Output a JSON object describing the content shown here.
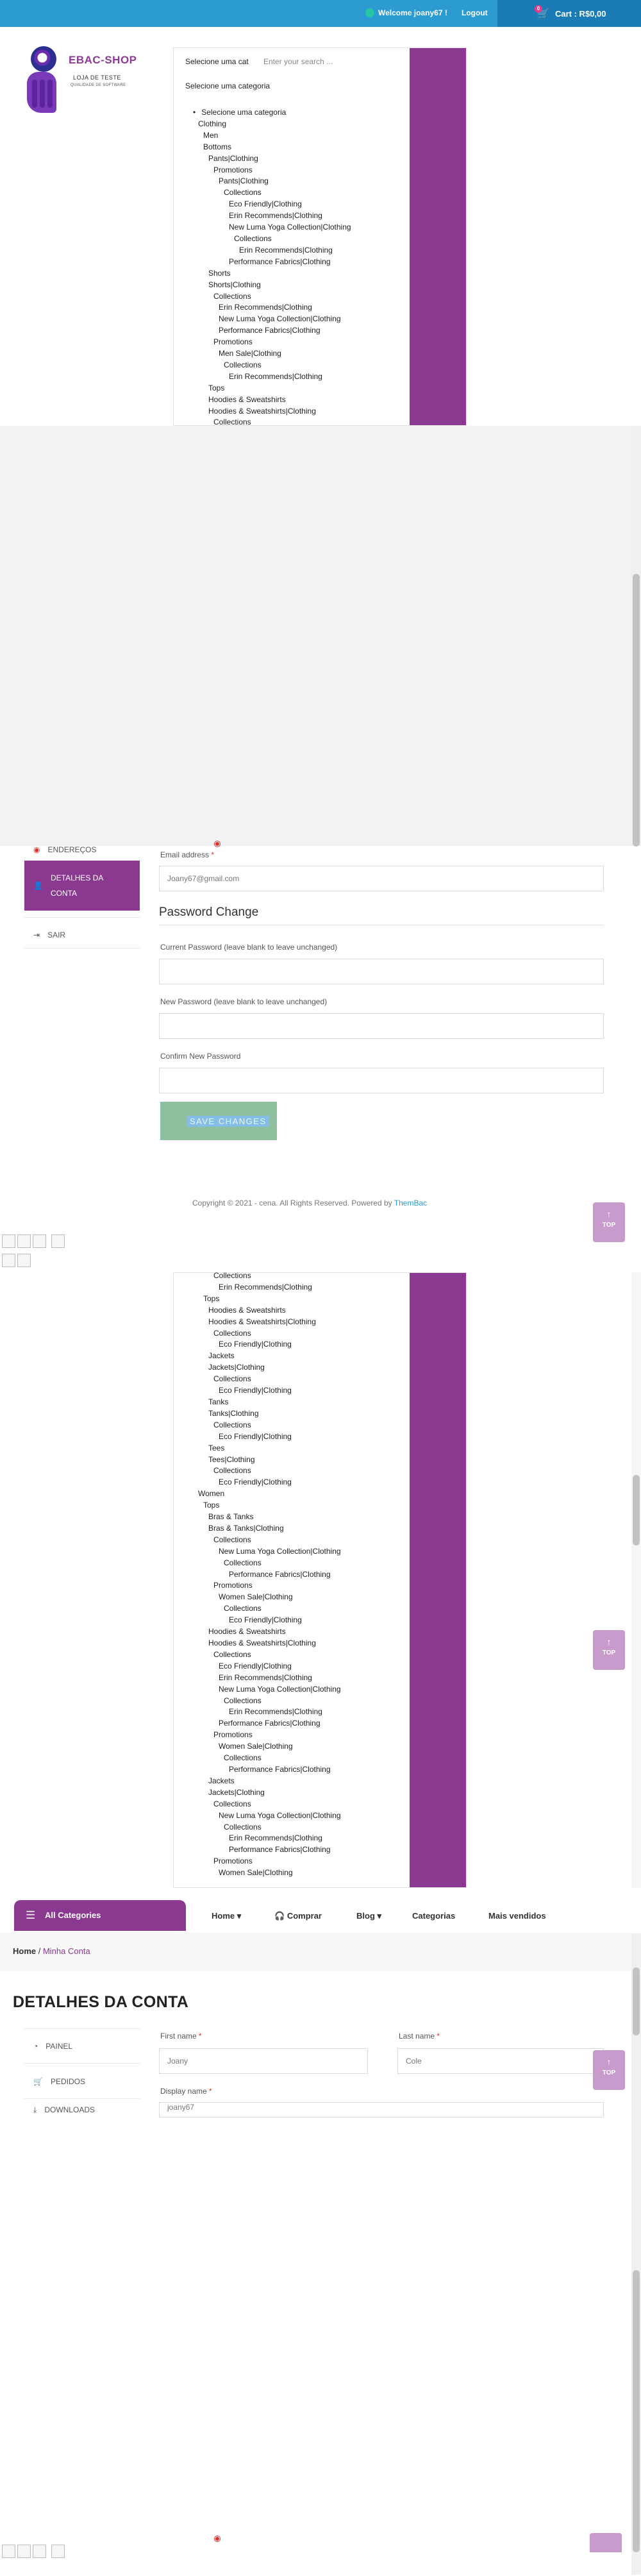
{
  "header": {
    "welcome": "Welcome joany67 !",
    "logout": "Logout",
    "wishlist_count": "0",
    "cart_count": "0",
    "cart_label": "Cart : R$0,00"
  },
  "logo": {
    "title": "EBAC-SHOP",
    "subtitle": "LOJA DE TESTE",
    "subtitle2": "QUALIDADE DE SOFTWARE"
  },
  "search": {
    "category_label": "Selecione uma cat",
    "placeholder": "Enter your search ...",
    "category_heading": "Selecione uma categoria"
  },
  "category_list_top": [
    {
      "label": "Selecione uma categoria",
      "indent": 0,
      "bullet": true
    },
    {
      "label": "Clothing",
      "indent": 1
    },
    {
      "label": "Men",
      "indent": 2
    },
    {
      "label": "Bottoms",
      "indent": 2
    },
    {
      "label": "Pants|Clothing",
      "indent": 3
    },
    {
      "label": "Promotions",
      "indent": 4
    },
    {
      "label": "Pants|Clothing",
      "indent": 5
    },
    {
      "label": "Collections",
      "indent": 6
    },
    {
      "label": "Eco Friendly|Clothing",
      "indent": 7
    },
    {
      "label": "Erin Recommends|Clothing",
      "indent": 7
    },
    {
      "label": "New Luma Yoga Collection|Clothing",
      "indent": 7
    },
    {
      "label": "Collections",
      "indent": 8
    },
    {
      "label": "Erin Recommends|Clothing",
      "indent": 9
    },
    {
      "label": "Performance Fabrics|Clothing",
      "indent": 7
    },
    {
      "label": "Shorts",
      "indent": 3
    },
    {
      "label": "Shorts|Clothing",
      "indent": 3
    },
    {
      "label": "Collections",
      "indent": 4
    },
    {
      "label": "Erin Recommends|Clothing",
      "indent": 5
    },
    {
      "label": "New Luma Yoga Collection|Clothing",
      "indent": 5
    },
    {
      "label": "Performance Fabrics|Clothing",
      "indent": 5
    },
    {
      "label": "Promotions",
      "indent": 4
    },
    {
      "label": "Men Sale|Clothing",
      "indent": 5
    },
    {
      "label": "Collections",
      "indent": 6
    },
    {
      "label": "Erin Recommends|Clothing",
      "indent": 7
    },
    {
      "label": "Tops",
      "indent": 3
    },
    {
      "label": "Hoodies & Sweatshirts",
      "indent": 3
    },
    {
      "label": "Hoodies & Sweatshirts|Clothing",
      "indent": 3
    },
    {
      "label": "Collections",
      "indent": 4
    }
  ],
  "category_list_bottom": [
    {
      "label": "Collections",
      "indent": 4
    },
    {
      "label": "Erin Recommends|Clothing",
      "indent": 5
    },
    {
      "label": "Tops",
      "indent": 2
    },
    {
      "label": "Hoodies & Sweatshirts",
      "indent": 3
    },
    {
      "label": "Hoodies & Sweatshirts|Clothing",
      "indent": 3
    },
    {
      "label": "Collections",
      "indent": 4
    },
    {
      "label": "Eco Friendly|Clothing",
      "indent": 5
    },
    {
      "label": "Jackets",
      "indent": 3
    },
    {
      "label": "Jackets|Clothing",
      "indent": 3
    },
    {
      "label": "Collections",
      "indent": 4
    },
    {
      "label": "Eco Friendly|Clothing",
      "indent": 5
    },
    {
      "label": "Tanks",
      "indent": 3
    },
    {
      "label": "Tanks|Clothing",
      "indent": 3
    },
    {
      "label": "Collections",
      "indent": 4
    },
    {
      "label": "Eco Friendly|Clothing",
      "indent": 5
    },
    {
      "label": "Tees",
      "indent": 3
    },
    {
      "label": "Tees|Clothing",
      "indent": 3
    },
    {
      "label": "Collections",
      "indent": 4
    },
    {
      "label": "Eco Friendly|Clothing",
      "indent": 5
    },
    {
      "label": "Women",
      "indent": 1
    },
    {
      "label": "Tops",
      "indent": 2
    },
    {
      "label": "Bras & Tanks",
      "indent": 3
    },
    {
      "label": "Bras & Tanks|Clothing",
      "indent": 3
    },
    {
      "label": "Collections",
      "indent": 4
    },
    {
      "label": "New Luma Yoga Collection|Clothing",
      "indent": 5
    },
    {
      "label": "Collections",
      "indent": 6
    },
    {
      "label": "Performance Fabrics|Clothing",
      "indent": 7
    },
    {
      "label": "Promotions",
      "indent": 4
    },
    {
      "label": "Women Sale|Clothing",
      "indent": 5
    },
    {
      "label": "Collections",
      "indent": 6
    },
    {
      "label": "Eco Friendly|Clothing",
      "indent": 7
    },
    {
      "label": "Hoodies & Sweatshirts",
      "indent": 3
    },
    {
      "label": "Hoodies & Sweatshirts|Clothing",
      "indent": 3
    },
    {
      "label": "Collections",
      "indent": 4
    },
    {
      "label": "Eco Friendly|Clothing",
      "indent": 5
    },
    {
      "label": "Erin Recommends|Clothing",
      "indent": 5
    },
    {
      "label": "New Luma Yoga Collection|Clothing",
      "indent": 5
    },
    {
      "label": "Collections",
      "indent": 6
    },
    {
      "label": "Erin Recommends|Clothing",
      "indent": 7
    },
    {
      "label": "Performance Fabrics|Clothing",
      "indent": 5
    },
    {
      "label": "Promotions",
      "indent": 4
    },
    {
      "label": "Women Sale|Clothing",
      "indent": 5
    },
    {
      "label": "Collections",
      "indent": 6
    },
    {
      "label": "Performance Fabrics|Clothing",
      "indent": 7
    },
    {
      "label": "Jackets",
      "indent": 3
    },
    {
      "label": "Jackets|Clothing",
      "indent": 3
    },
    {
      "label": "Collections",
      "indent": 4
    },
    {
      "label": "New Luma Yoga Collection|Clothing",
      "indent": 5
    },
    {
      "label": "Collections",
      "indent": 6
    },
    {
      "label": "Erin Recommends|Clothing",
      "indent": 7
    },
    {
      "label": "Performance Fabrics|Clothing",
      "indent": 7
    },
    {
      "label": "Promotions",
      "indent": 4
    },
    {
      "label": "Women Sale|Clothing",
      "indent": 5
    }
  ],
  "account_nav": {
    "enderecos": "ENDEREÇOS",
    "detalhes": "DETALHES DA CONTA",
    "sair": "SAIR",
    "painel": "PAINEL",
    "pedidos": "PEDIDOS",
    "downloads": "DOWNLOADS"
  },
  "form": {
    "email_label": "Email address",
    "email_value": "Joany67@gmail.com",
    "password_section": "Password Change",
    "current_password_label": "Current Password (leave blank to leave unchanged)",
    "new_password_label": "New Password (leave blank to leave unchanged)",
    "confirm_password_label": "Confirm New Password",
    "save_label": "SAVE CHANGES",
    "first_name_label": "First name",
    "first_name_value": "Joany",
    "last_name_label": "Last name",
    "last_name_value": "Cole",
    "display_name_label": "Display name",
    "display_name_value": "joany67",
    "required_mark": "*"
  },
  "footer": {
    "copyright": "Copyright © 2021 - cena. All Rights Reserved. Powered by",
    "brand": "ThemBac"
  },
  "back_to_top": {
    "label": "TOP",
    "arrow": "↑"
  },
  "main_nav": {
    "all_categories": "All Categories",
    "home": "Home",
    "comprar": "Comprar",
    "blog": "Blog",
    "categorias": "Categorias",
    "mais_vendidos": "Mais vendidos"
  },
  "breadcrumb": {
    "home": "Home",
    "separator": " / ",
    "current": "Minha Conta"
  },
  "page_title": "DETALHES DA CONTA",
  "colors": {
    "topbar": "#2b9bd1",
    "accent": "#8b3890",
    "cart": "#1a7bb6"
  }
}
